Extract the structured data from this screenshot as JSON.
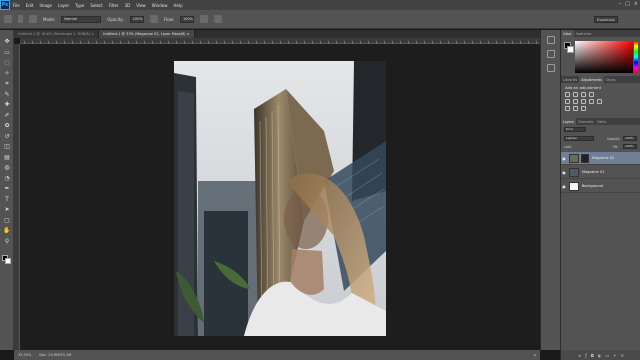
{
  "app": {
    "logo": "Ps",
    "menu": [
      "File",
      "Edit",
      "Image",
      "Layer",
      "Type",
      "Select",
      "Filter",
      "3D",
      "View",
      "Window",
      "Help"
    ]
  },
  "options_bar": {
    "mode_label": "Mode:",
    "mode_value": "Normal",
    "opacity_label": "Opacity:",
    "opacity_value": "100%",
    "flow_label": "Flow:",
    "flow_value": "100%",
    "workspace": "Essentials"
  },
  "tabs": [
    {
      "label": "Untitled-1 @ 16.6% (Rectangle 1, RGB/8) ×"
    },
    {
      "label": "Untitled-1 @ 33% (Magazine 02, Layer Mask/8) ×"
    }
  ],
  "status_bar": {
    "zoom": "33.33%",
    "doc": "Doc: 24.9M/93.1M"
  },
  "panels": {
    "color_tabs": [
      "Color",
      "Swatches"
    ],
    "adjust_tabs": [
      "Libraries",
      "Adjustments",
      "Styles"
    ],
    "adjustments_title": "Add an adjustment",
    "layers_tabs": [
      "Layers",
      "Channels",
      "Paths"
    ],
    "kind_label": "Kind",
    "blend_mode": "Lighten",
    "opacity_label": "Opacity:",
    "opacity_value": "100%",
    "lock_label": "Lock:",
    "fill_label": "Fill:",
    "fill_value": "100%",
    "layers": [
      {
        "name": "Magazine 02",
        "selected": true
      },
      {
        "name": "Magazine 01",
        "selected": false
      },
      {
        "name": "Background",
        "selected": false
      }
    ]
  },
  "icons": {
    "visibility": "eye-icon",
    "lock": "lock-icon",
    "link": "link-icon"
  }
}
